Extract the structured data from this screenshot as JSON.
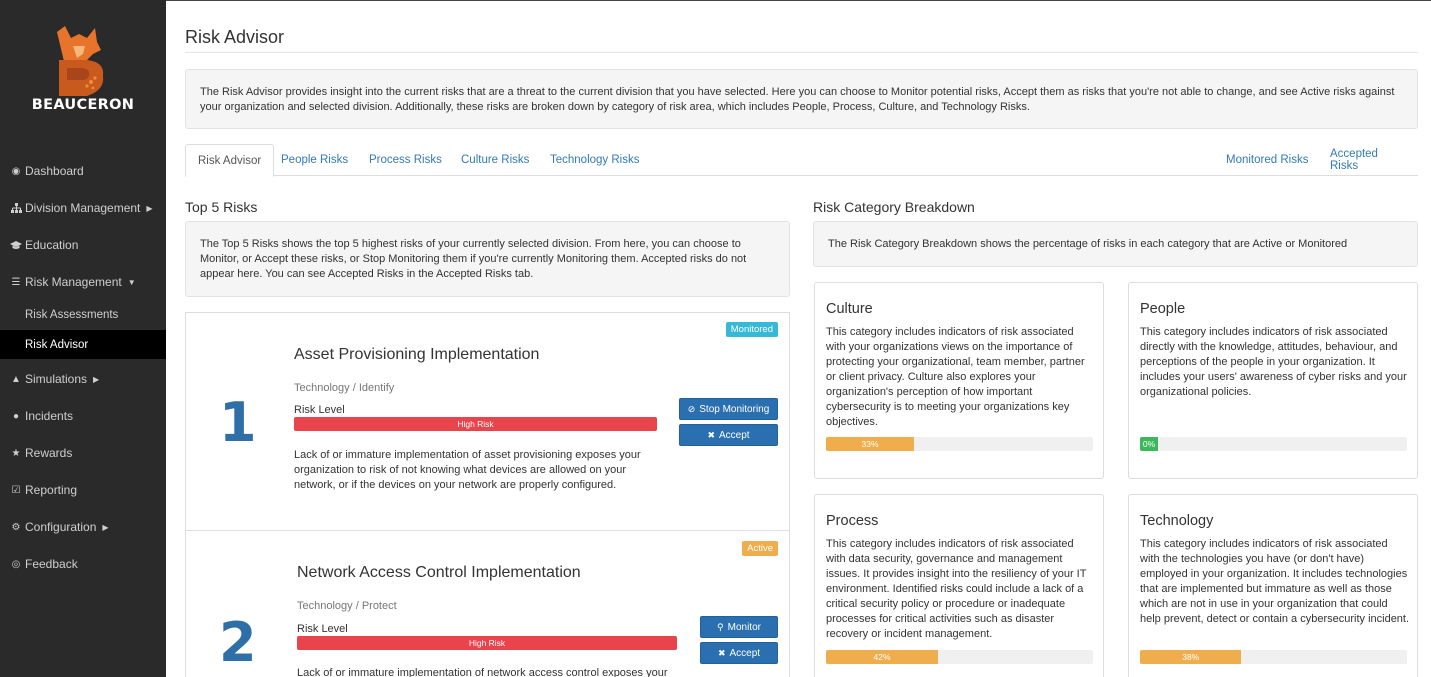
{
  "brand": {
    "name": "BEAUCERON"
  },
  "sidebar": {
    "items": [
      {
        "label": "Dashboard",
        "icon": "dashboard-icon"
      },
      {
        "label": "Division Management",
        "icon": "sitemap-icon"
      },
      {
        "label": "Education",
        "icon": "graduation-cap-icon"
      },
      {
        "label": "Risk Management",
        "icon": "list-icon"
      },
      {
        "label": "Risk Assessments"
      },
      {
        "label": "Risk Advisor"
      },
      {
        "label": "Simulations",
        "icon": "warning-icon"
      },
      {
        "label": "Incidents",
        "icon": "info-icon"
      },
      {
        "label": "Rewards",
        "icon": "star-icon"
      },
      {
        "label": "Reporting",
        "icon": "check-square-icon"
      },
      {
        "label": "Configuration",
        "icon": "gear-icon"
      },
      {
        "label": "Feedback",
        "icon": "life-ring-icon"
      }
    ]
  },
  "page": {
    "title": "Risk Advisor",
    "intro": "The Risk Advisor provides insight into the current risks that are a threat to the current division that you have selected. Here you can choose to Monitor potential risks, Accept them as risks that you're not able to change, and see Active risks against your organization and selected division. Additionally, these risks are broken down by category of risk area, which includes People, Process, Culture, and Technology Risks."
  },
  "tabs": {
    "left": [
      "Risk Advisor",
      "People Risks",
      "Process Risks",
      "Culture Risks",
      "Technology Risks"
    ],
    "right": [
      "Monitored Risks",
      "Accepted Risks"
    ]
  },
  "top_risks": {
    "title": "Top 5 Risks",
    "description": "The Top 5 Risks shows the top 5 highest risks of your currently selected division. From here, you can choose to Monitor, or Accept these risks, or Stop Monitoring them if you're currently Monitoring them. Accepted risks do not appear here. You can see Accepted Risks in the Accepted Risks tab.",
    "risk_level_label": "Risk Level",
    "items": [
      {
        "rank": "1",
        "badge": "Monitored",
        "title": "Asset Provisioning Implementation",
        "category": "Technology / Identify",
        "level": "High Risk",
        "description": "Lack of or immature implementation of asset provisioning exposes your organization to risk of not knowing what devices are allowed on your network, or if the devices on your network are properly configured.",
        "primary_action": "Stop Monitoring",
        "secondary_action": "Accept"
      },
      {
        "rank": "2",
        "badge": "Active",
        "title": "Network Access Control Implementation",
        "category": "Technology / Protect",
        "level": "High Risk",
        "description": "Lack of or immature implementation of network access control exposes your",
        "primary_action": "Monitor",
        "secondary_action": "Accept"
      }
    ]
  },
  "breakdown": {
    "title": "Risk Category Breakdown",
    "description": "The Risk Category Breakdown shows the percentage of risks in each category that are Active or Monitored",
    "categories": [
      {
        "name": "Culture",
        "description": "This category includes indicators of risk associated with your organizations views on the importance of protecting your organizational, team member, partner or client privacy. Culture also explores your organization's perception of how important cybersecurity is to meeting your organizations key objectives.",
        "percent": 33,
        "percent_label": "33%",
        "color": "#f0ad4e"
      },
      {
        "name": "People",
        "description": "This category includes indicators of risk associated directly with the knowledge, attitudes, behaviour, and perceptions of the people in your organization. It includes your users' awareness of cyber risks and your organizational policies.",
        "percent": 0,
        "percent_label": "0%",
        "color": "#3cb85c"
      },
      {
        "name": "Process",
        "description": "This category includes indicators of risk associated with data security, governance and management issues. It provides insight into the resiliency of your IT environment. Identified risks could include a lack of a critical security policy or procedure or inadequate processes for critical activities such as disaster recovery or incident management.",
        "percent": 42,
        "percent_label": "42%",
        "color": "#f0ad4e"
      },
      {
        "name": "Technology",
        "description": "This category includes indicators of risk associated with the technologies you have (or don't have) employed in your organization. It includes technologies that are implemented but immature as well as those which are not in use in your organization that could help prevent, detect or contain a cybersecurity incident.",
        "percent": 38,
        "percent_label": "38%",
        "color": "#f0ad4e"
      }
    ]
  },
  "colors": {
    "sidebar": "#2a2a2a",
    "link": "#337ab7",
    "primary_button": "#2a6faf",
    "danger": "#e9434b",
    "badge_monitored": "#35b9d6",
    "badge_active": "#f0ad4e",
    "rank": "#2f6fa8"
  }
}
